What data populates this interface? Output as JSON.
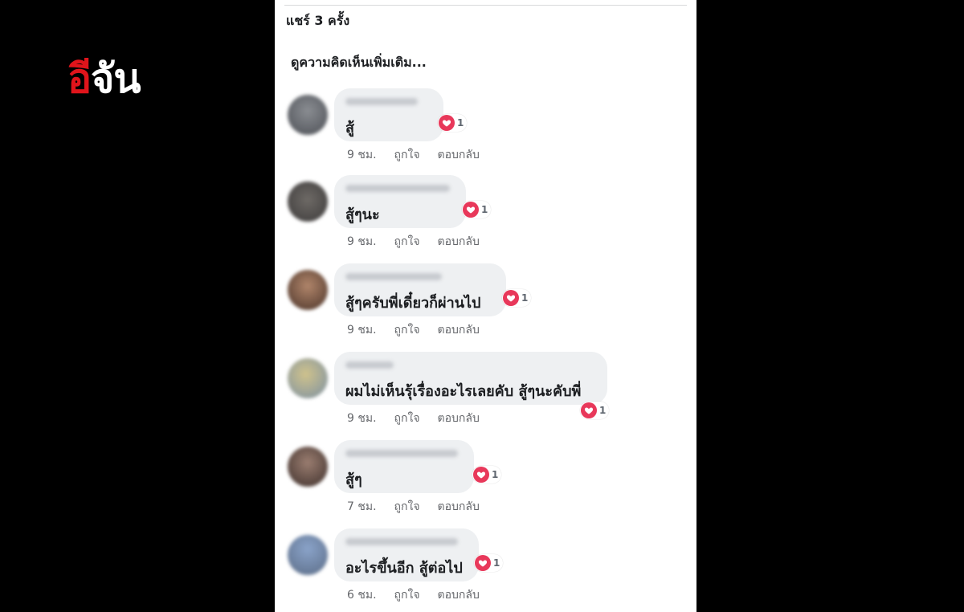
{
  "logo": {
    "part1": "อี",
    "part2": "จัน",
    "accent_color": "#e0141b"
  },
  "post": {
    "share_count": "แชร์ 3 ครั้ง",
    "more_comments": "ดูความคิดเห็นเพิ่มเติม..."
  },
  "comments": [
    {
      "text": "สู้",
      "time": "9 ชม.",
      "like": "ถูกใจ",
      "reply": "ตอบกลับ",
      "reaction_count": "1",
      "reaction": "love-icon"
    },
    {
      "text": "สู้ๆนะ",
      "time": "9 ชม.",
      "like": "ถูกใจ",
      "reply": "ตอบกลับ",
      "reaction_count": "1",
      "reaction": "love-icon"
    },
    {
      "text": "สู้ๆครับพี่เดี๋ยวก็ผ่านไป",
      "time": "9 ชม.",
      "like": "ถูกใจ",
      "reply": "ตอบกลับ",
      "reaction_count": "1",
      "reaction": "love-icon"
    },
    {
      "text": "ผมไม่เห็นรุ้เรื่องอะไรเลยคับ สู้ๆนะคับพี่",
      "time": "9 ชม.",
      "like": "ถูกใจ",
      "reply": "ตอบกลับ",
      "reaction_count": "1",
      "reaction": "love-icon"
    },
    {
      "text": "สู้ๆ",
      "time": "7 ชม.",
      "like": "ถูกใจ",
      "reply": "ตอบกลับ",
      "reaction_count": "1",
      "reaction": "love-icon"
    },
    {
      "text": "อะไรขึ้นอีก สู้ต่อไป",
      "time": "6 ชม.",
      "like": "ถูกใจ",
      "reply": "ตอบกลับ",
      "reaction_count": "1",
      "reaction": "love-icon"
    }
  ],
  "colors": {
    "bubble": "#eef0f2",
    "love": "#e8385a",
    "meta_text": "#65676b"
  }
}
